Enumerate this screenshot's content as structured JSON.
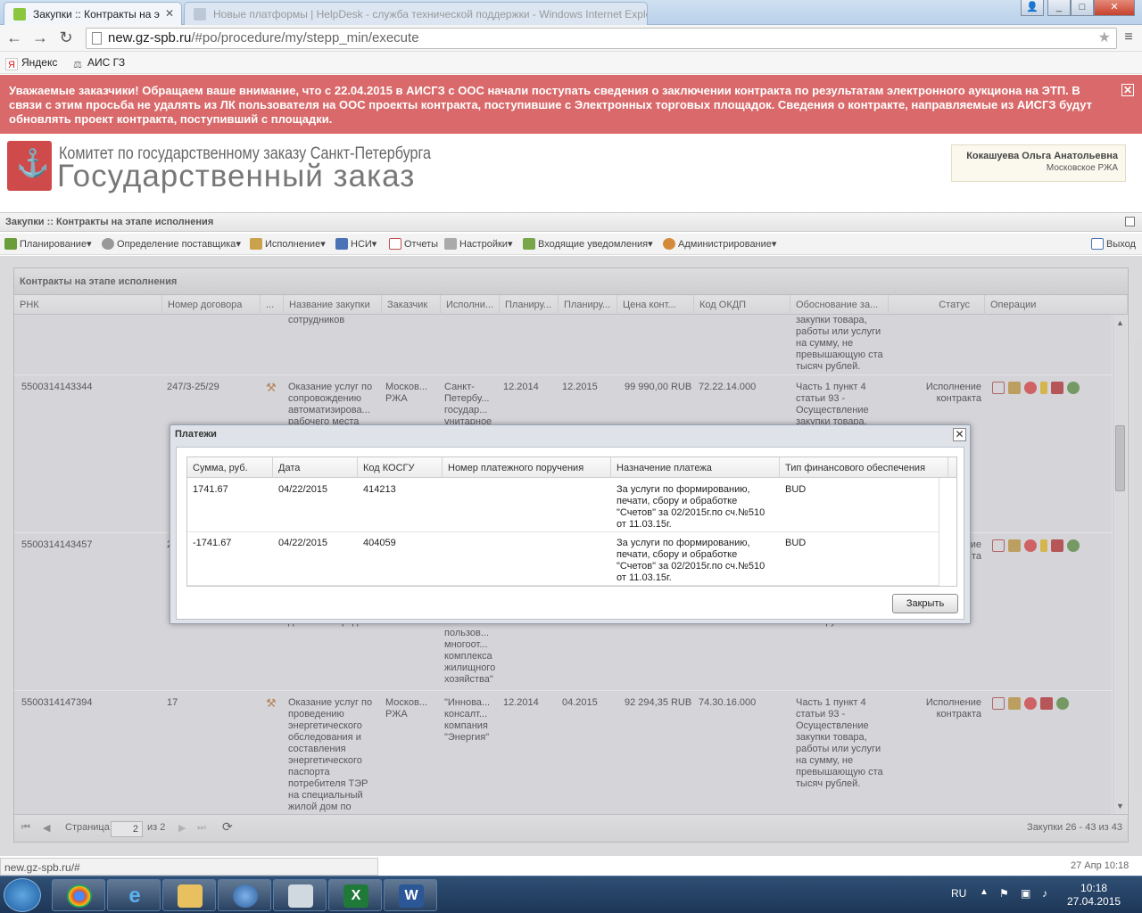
{
  "browser": {
    "tabs": [
      {
        "label": "Закупки :: Контракты на э"
      },
      {
        "label": "Новые платформы | HelpDesk - служба технической поддержки - Windows Internet Explorer"
      }
    ],
    "url_domain": "new.gz-spb.ru",
    "url_path": "/#po/procedure/my/stepp_min/execute",
    "bookmarks": [
      {
        "label": "Яндекс",
        "icon": "yandex-icon"
      },
      {
        "label": "АИС ГЗ",
        "icon": "ais-icon"
      }
    ],
    "status_url": "new.gz-spb.ru/#"
  },
  "alert": {
    "text": "Уважаемые заказчики! Обращаем ваше внимание, что с 22.04.2015 в АИСГЗ с ООС начали поступать сведения о заключении контракта по результатам электронного аукциона на ЭТП. В связи с этим просьба не удалять из ЛК пользователя на ООС проекты контракта, поступившие с Электронных торговых площадок. Сведения о контракте, направляемые из АИСГЗ будут обновлять проект контракта, поступивший с площадки."
  },
  "header": {
    "org_name": "Комитет по государственному заказу Санкт-Петербурга",
    "site_title": "Государственный заказ",
    "user_name": "Кокашуева Ольга Анатольевна",
    "user_org": "Московское РЖА"
  },
  "breadcrumb": "Закупки :: Контракты на этапе исполнения",
  "menu": [
    {
      "label": "Планирование",
      "icon": "planning-icon",
      "color": "#6b9e3a"
    },
    {
      "label": "Определение поставщика",
      "icon": "gear-icon",
      "color": "#888888"
    },
    {
      "label": "Исполнение",
      "icon": "execution-icon",
      "color": "#c9a24b"
    },
    {
      "label": "НСИ",
      "icon": "book-icon",
      "color": "#4a74b5"
    },
    {
      "label": "Отчеты",
      "icon": "report-icon",
      "color": "#c05050"
    },
    {
      "label": "Настройки",
      "icon": "wrench-icon",
      "color": "#888888"
    },
    {
      "label": "Входящие уведомления",
      "icon": "inbox-icon",
      "color": "#7aa64a"
    },
    {
      "label": "Администрирование",
      "icon": "admin-icon",
      "color": "#d38b3a"
    }
  ],
  "logout_label": "Выход",
  "panel": {
    "title": "Контракты на этапе исполнения",
    "columns": [
      "РНК",
      "Номер договора",
      "...",
      "Название закупки",
      "Заказчик",
      "Исполни...",
      "Планиру...",
      "Планиру...",
      "Цена конт...",
      "Код ОКДП",
      "Обоснование за...",
      "Статус",
      "Операции"
    ],
    "rows": [
      {
        "rnk": "",
        "contract": "",
        "name": "сотрудников",
        "customer": "",
        "supplier": "",
        "plan1": "",
        "plan2": "",
        "price": "",
        "okdp": "",
        "basis": "закупки товара,\nработы или услуги\nна сумму, не\nпревышающую ста\nтысяч рублей.",
        "status": ""
      },
      {
        "rnk": "5500314143344",
        "contract": "247/3-25/29",
        "name": "Оказание услуг по\nсопровождению\nавтоматизирова...\nрабочего места",
        "customer": "Москов...\nРЖА",
        "supplier": "Санкт-\nПетербу...\nгосудар...\nунитарное",
        "plan1": "12.2014",
        "plan2": "12.2015",
        "price": "99 990,00 RUB",
        "okdp": "72.22.14.000",
        "basis": "Часть 1 пункт 4\nстатьи 93 -\nОсуществление\nзакупки товара,",
        "status": "Исполнение\nконтракта"
      },
      {
        "rnk": "5500314143457",
        "contract": "2",
        "name": "денежных средств",
        "customer": "",
        "supplier": "личного\nпользов...\nмногоот...\nкомплекса\nжилищного\nхозяйства\"",
        "plan1": "",
        "plan2": "",
        "price": "",
        "okdp": "",
        "basis": "тысяч рублей.",
        "status": "ие\nта"
      },
      {
        "rnk": "5500314147394",
        "contract": "17",
        "name": "Оказание услуг по\nпроведению\nэнергетического\nобследования и\nсоставления\nэнергетического\nпаспорта\nпотребителя ТЭР\nна специальный\nжилой дом по\nадресу: г.СПб",
        "customer": "Москов...\nРЖА",
        "supplier": "\"Иннова...\nконсалт...\nкомпания\n\"Энергия\"",
        "plan1": "12.2014",
        "plan2": "04.2015",
        "price": "92 294,35 RUB",
        "okdp": "74.30.16.000",
        "basis": "Часть 1 пункт 4\nстатьи 93 -\nОсуществление\nзакупки товара,\nработы или услуги\nна сумму, не\nпревышающую ста\nтысяч рублей.",
        "status": "Исполнение\nконтракта"
      }
    ],
    "pager": {
      "page_label": "Страница",
      "page_value": "2",
      "of_label": "из 2",
      "summary": "Закупки 26 - 43 из 43"
    }
  },
  "dialog": {
    "title": "Платежи",
    "columns": [
      "Сумма, руб.",
      "Дата",
      "Код КОСГУ",
      "Номер платежного поручения",
      "Назначение платежа",
      "Тип финансового обеспечения"
    ],
    "rows": [
      {
        "sum": "1741.67",
        "date": "04/22/2015",
        "kosgu": "414213",
        "order": "",
        "purpose": "За услуги по формированию,\nпечати, сбору и обработке\n\"Счетов\" за 02/2015г.по сч.№510\nот 11.03.15г.",
        "fin": "BUD"
      },
      {
        "sum": "-1741.67",
        "date": "04/22/2015",
        "kosgu": "404059",
        "order": "",
        "purpose": "За услуги по формированию,\nпечати, сбору и обработке\n\"Счетов\" за 02/2015г.по сч.№510\nот 11.03.15г.",
        "fin": "BUD"
      }
    ],
    "close_label": "Закрыть"
  },
  "timestamp": "27 Апр 10:18",
  "taskbar": {
    "lang": "RU",
    "time": "10:18",
    "date": "27.04.2015"
  }
}
